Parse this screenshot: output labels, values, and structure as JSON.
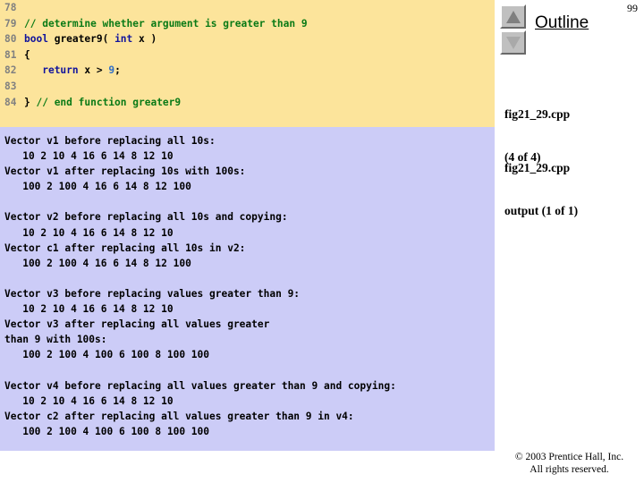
{
  "slide": {
    "page_number": "99",
    "colors": {
      "code_panel_bg": "#fce49b",
      "output_panel_bg": "#ccccf7",
      "comment": "#0a7a16",
      "keyword": "#10139c",
      "number": "#2e6ec9",
      "line_number": "#808080",
      "slide_bg": "#ffffff"
    }
  },
  "code_panel": {
    "lines": [
      {
        "number": "78",
        "tokens": []
      },
      {
        "number": "79",
        "tokens": [
          {
            "text": "// determine whether argument is greater than 9",
            "type": "comment"
          }
        ]
      },
      {
        "number": "80",
        "tokens": [
          {
            "text": "bool",
            "type": "key"
          },
          {
            "text": " ",
            "type": "plain"
          },
          {
            "text": "greater9( ",
            "type": "plain"
          },
          {
            "text": "int",
            "type": "key"
          },
          {
            "text": " x )",
            "type": "plain"
          }
        ]
      },
      {
        "number": "81",
        "tokens": [
          {
            "text": "{",
            "type": "plain"
          }
        ]
      },
      {
        "number": "82",
        "tokens": [
          {
            "text": "   ",
            "type": "plain"
          },
          {
            "text": "return",
            "type": "key"
          },
          {
            "text": " x > ",
            "type": "plain"
          },
          {
            "text": "9",
            "type": "num"
          },
          {
            "text": ";",
            "type": "plain"
          }
        ]
      },
      {
        "number": "83",
        "tokens": []
      },
      {
        "number": "84",
        "tokens": [
          {
            "text": "} ",
            "type": "plain"
          },
          {
            "text": "// end function greater9",
            "type": "comment"
          }
        ]
      }
    ]
  },
  "output_panel": {
    "lines": [
      "Vector v1 before replacing all 10s:",
      "   10 2 10 4 16 6 14 8 12 10",
      "Vector v1 after replacing 10s with 100s:",
      "   100 2 100 4 16 6 14 8 12 100",
      "",
      "Vector v2 before replacing all 10s and copying:",
      "   10 2 10 4 16 6 14 8 12 10",
      "Vector c1 after replacing all 10s in v2:",
      "   100 2 100 4 16 6 14 8 12 100",
      "",
      "Vector v3 before replacing values greater than 9:",
      "   10 2 10 4 16 6 14 8 12 10",
      "Vector v3 after replacing all values greater",
      "than 9 with 100s:",
      "   100 2 100 4 100 6 100 8 100 100",
      "",
      "Vector v4 before replacing all values greater than 9 and copying:",
      "   10 2 10 4 16 6 14 8 12 10",
      "Vector c2 after replacing all values greater than 9 in v4:",
      "   100 2 100 4 100 6 100 8 100 100"
    ]
  },
  "sidebar": {
    "title": "Outline",
    "scroll_up_label": "▲",
    "scroll_down_label": "▼",
    "items": [
      {
        "line1": "fig21_29.cpp",
        "line2": "(4 of 4)"
      },
      {
        "line1": "fig21_29.cpp",
        "line2": "output (1 of 1)"
      }
    ]
  },
  "footer": {
    "line1": "© 2003 Prentice Hall, Inc.",
    "line2": "All rights reserved."
  }
}
